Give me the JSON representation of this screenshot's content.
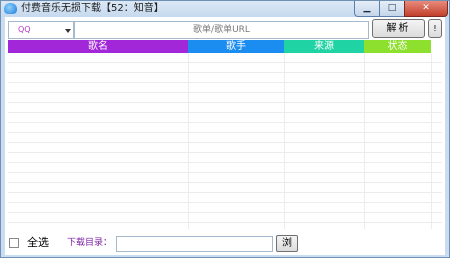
{
  "window": {
    "title": "付费音乐无损下载【52：知音】",
    "minimize_glyph": "▁",
    "maximize_glyph": "□",
    "close_glyph": "✕"
  },
  "toolbar": {
    "source_value": "QQ",
    "search_placeholder": "歌单/歌单URL",
    "parse_label": "解析",
    "info_label": "!"
  },
  "table": {
    "headers": [
      "歌名",
      "歌手",
      "来源",
      "状态"
    ],
    "header_colors": [
      "#a227d8",
      "#1b8df0",
      "#20d3a4",
      "#8ee02e"
    ],
    "rows": []
  },
  "footer": {
    "select_all_label": "全选",
    "download_dir_label": "下载目录：",
    "download_dir_value": "",
    "browse_label": "浏"
  }
}
